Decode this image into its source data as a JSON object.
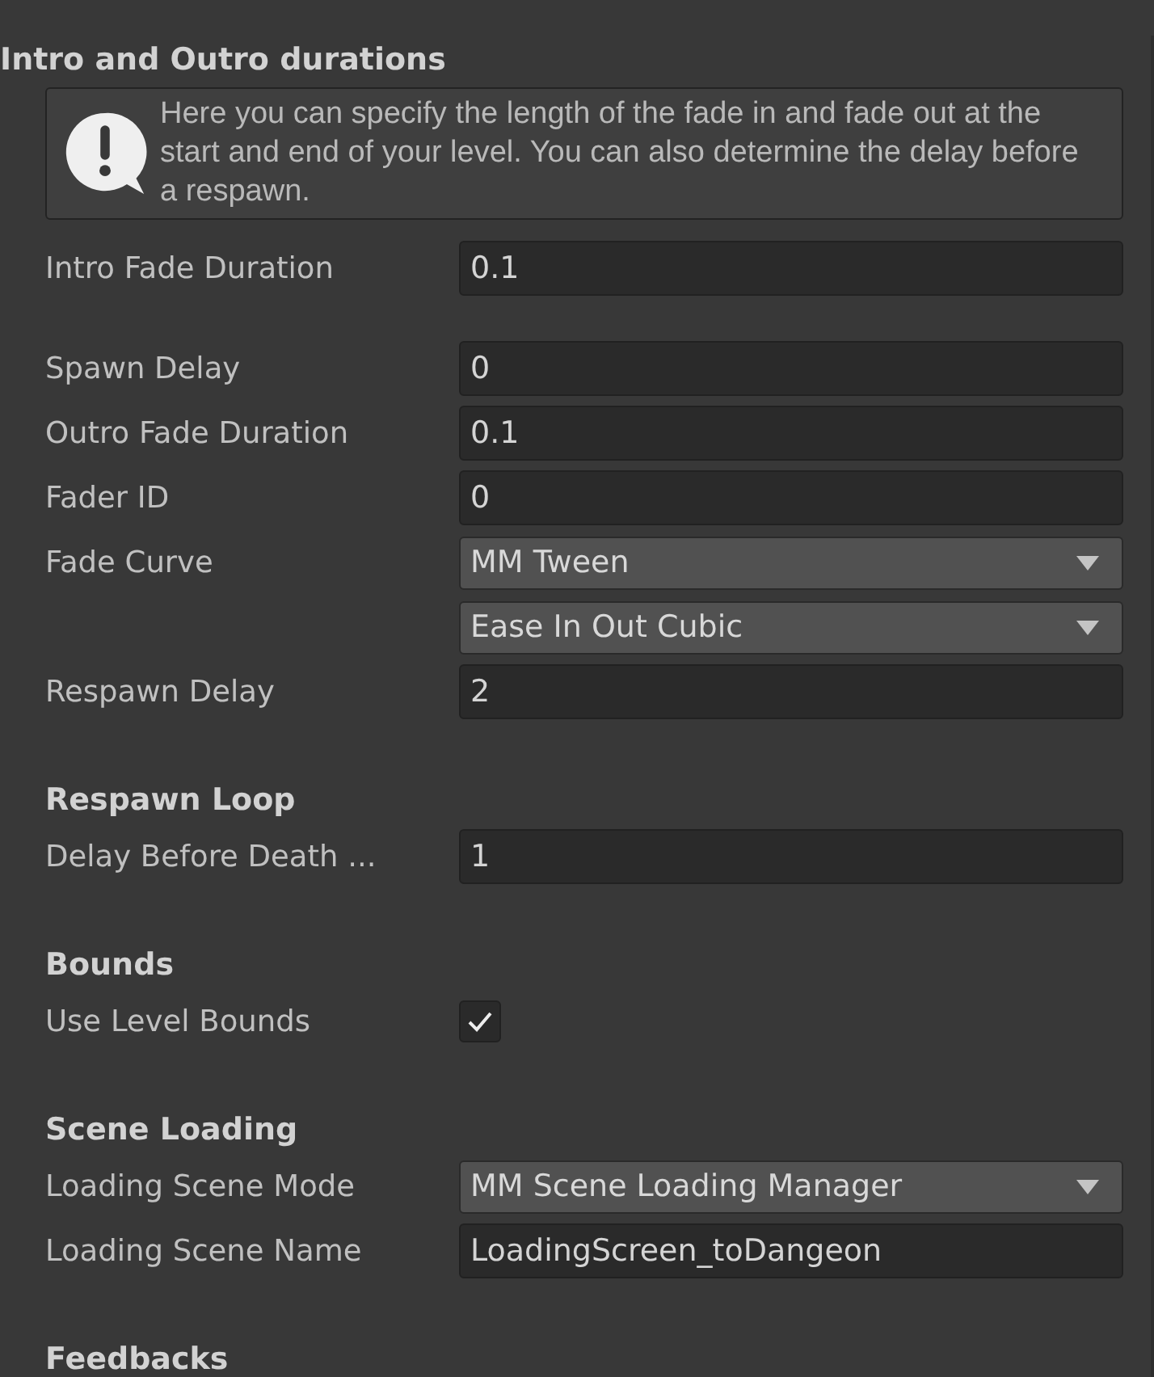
{
  "sections": [
    {
      "title": "Intro and Outro durations",
      "rows": [
        {
          "kind": "help",
          "text": "Here you can specify the length of the fade in and fade out at the start and end of your level. You can also determine the delay before a respawn."
        },
        {
          "kind": "field",
          "label": "Intro Fade Duration",
          "value": "0.1",
          "space_after": true
        },
        {
          "kind": "field",
          "label": "Spawn Delay",
          "value": "0"
        },
        {
          "kind": "field",
          "label": "Outro Fade Duration",
          "value": "0.1"
        },
        {
          "kind": "field",
          "label": "Fader ID",
          "value": "0"
        },
        {
          "kind": "dropdown",
          "label": "Fade Curve",
          "value": "MM Tween"
        },
        {
          "kind": "dropdown",
          "value": "Ease In Out Cubic"
        },
        {
          "kind": "field",
          "label": "Respawn Delay",
          "value": "2"
        }
      ]
    },
    {
      "title": "Respawn Loop",
      "rows": [
        {
          "kind": "field",
          "label": "Delay Before Death ...",
          "value": "1"
        }
      ]
    },
    {
      "title": "Bounds",
      "rows": [
        {
          "kind": "checkbox",
          "label": "Use Level Bounds",
          "checked": true
        }
      ]
    },
    {
      "title": "Scene Loading",
      "rows": [
        {
          "kind": "dropdown",
          "label": "Loading Scene Mode",
          "value": "MM Scene Loading Manager"
        },
        {
          "kind": "field",
          "label": "Loading Scene Name",
          "value": "LoadingScreen_toDangeon"
        }
      ]
    },
    {
      "title": "Feedbacks"
    }
  ]
}
